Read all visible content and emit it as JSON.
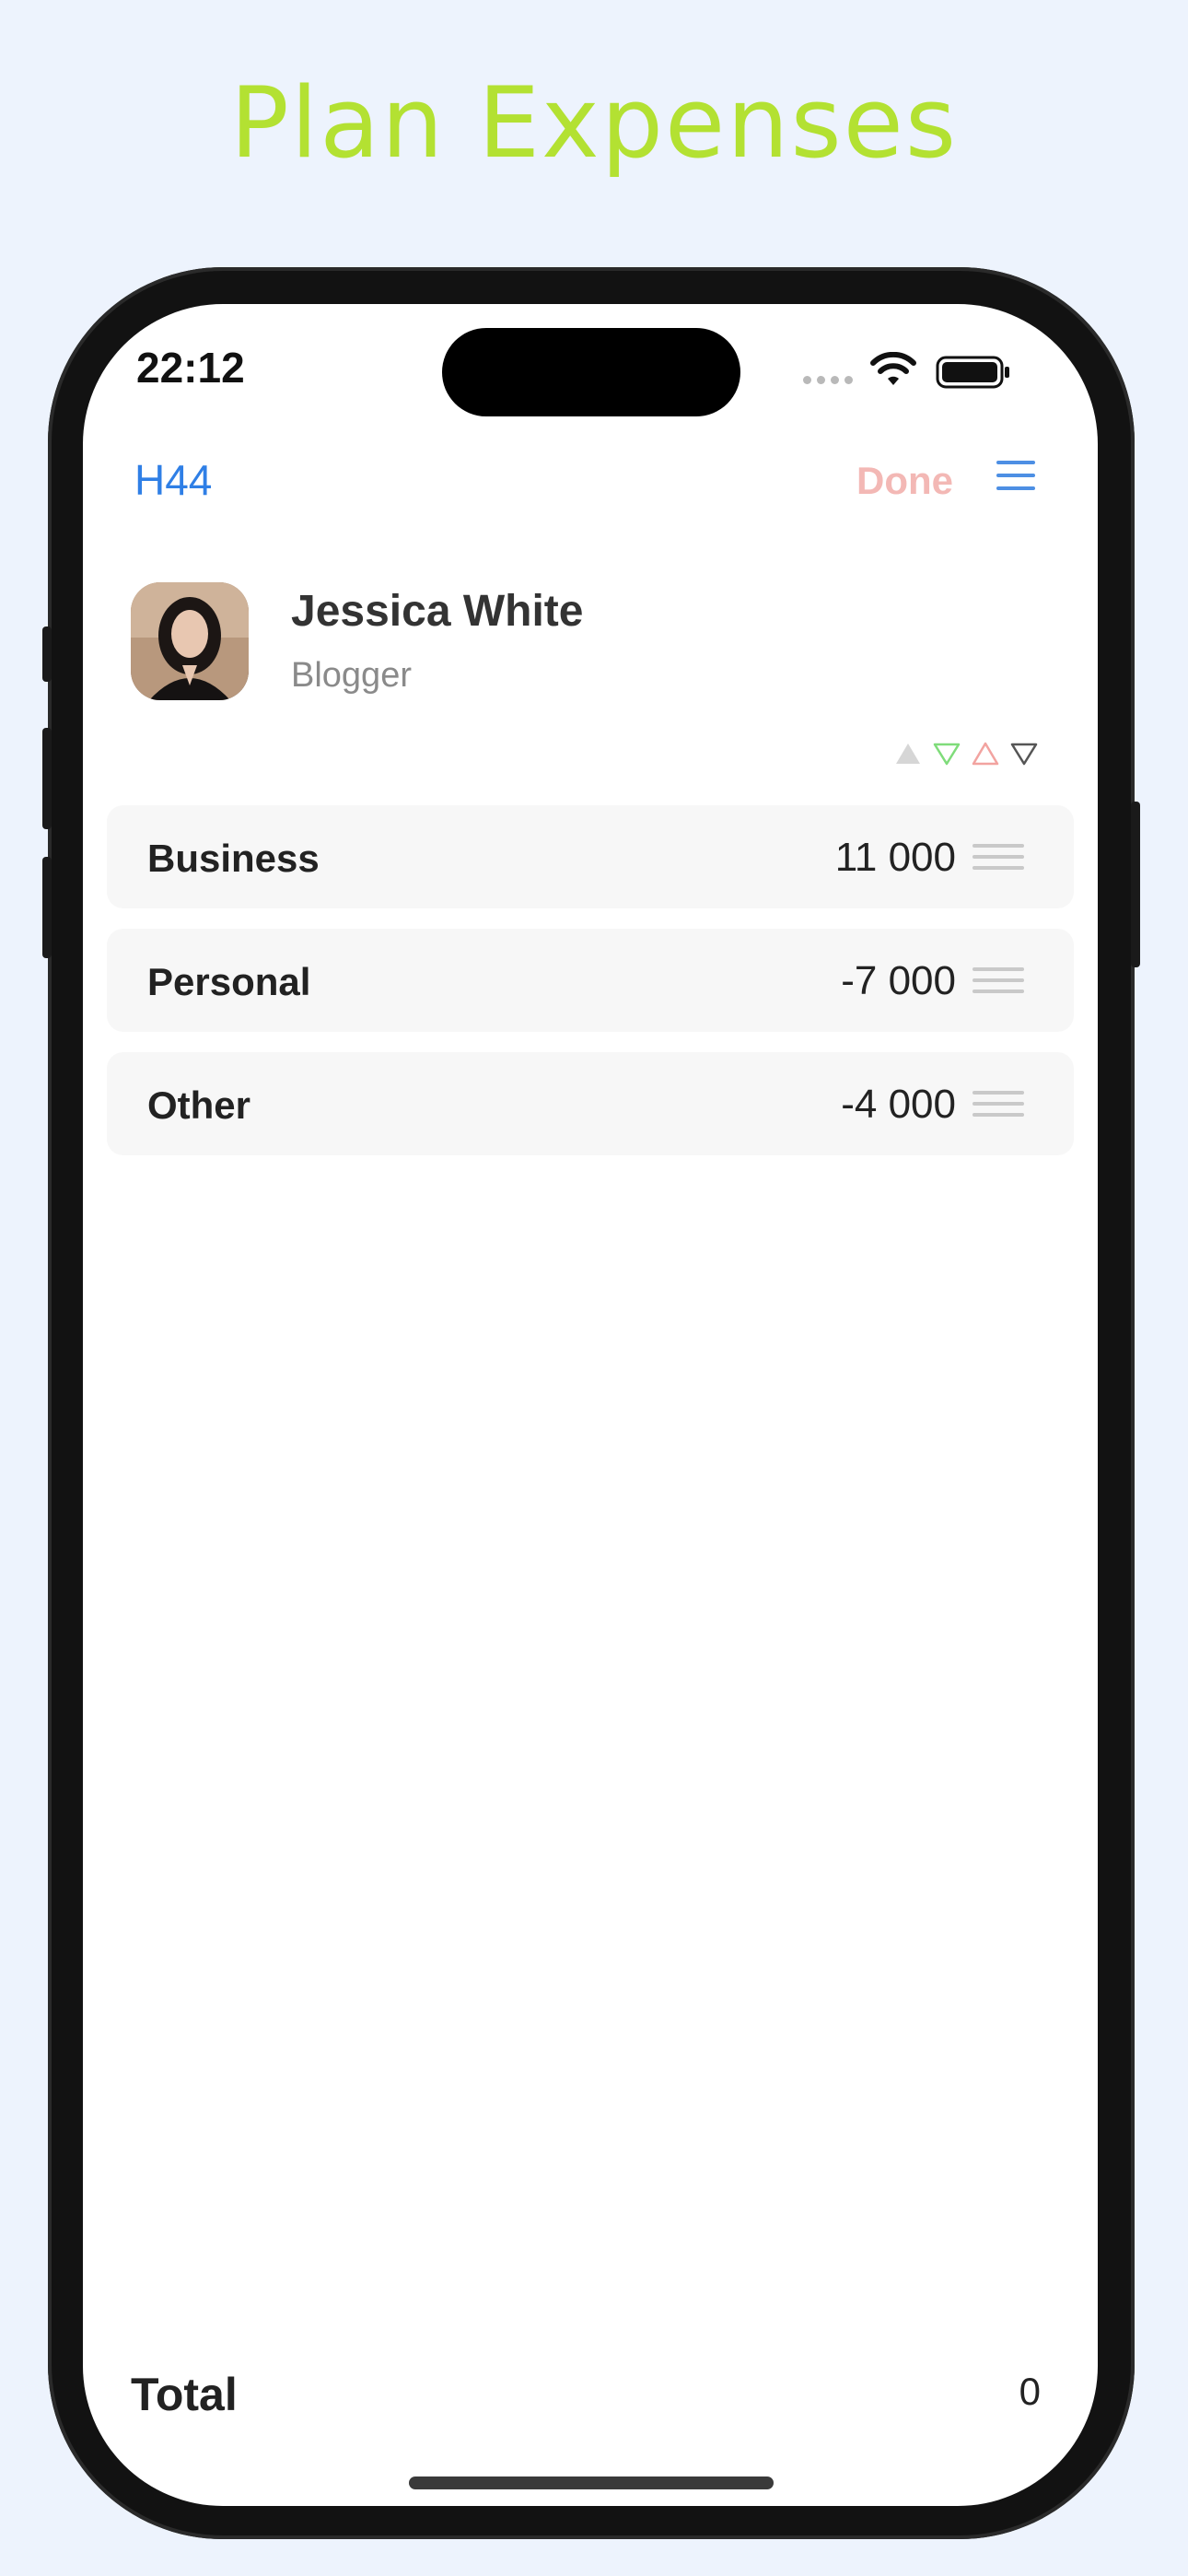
{
  "headline": "Plan Expenses",
  "status_bar": {
    "time": "22:12"
  },
  "nav": {
    "left_label": "H44",
    "done_label": "Done",
    "menu_icon": "hamburger-menu-icon"
  },
  "profile": {
    "name": "Jessica White",
    "role": "Blogger",
    "avatar_icon": "user-photo"
  },
  "sort_controls": [
    {
      "name": "sort-all-icon",
      "color": "#d6d6d6"
    },
    {
      "name": "sort-down-green-icon",
      "color": "#7fdc7a"
    },
    {
      "name": "sort-up-red-icon",
      "color": "#f2a3a0"
    },
    {
      "name": "sort-down-gray-icon",
      "color": "#555555"
    }
  ],
  "rows": [
    {
      "label": "Business",
      "value": "11 000"
    },
    {
      "label": "Personal",
      "value": "-7 000"
    },
    {
      "label": "Other",
      "value": "-4 000"
    }
  ],
  "total": {
    "label": "Total",
    "value": "0"
  },
  "colors": {
    "accent_blue": "#2f7fe6",
    "done_pink": "#f3b8b5",
    "headline_green": "#b3e132",
    "background": "#edf3fd"
  }
}
